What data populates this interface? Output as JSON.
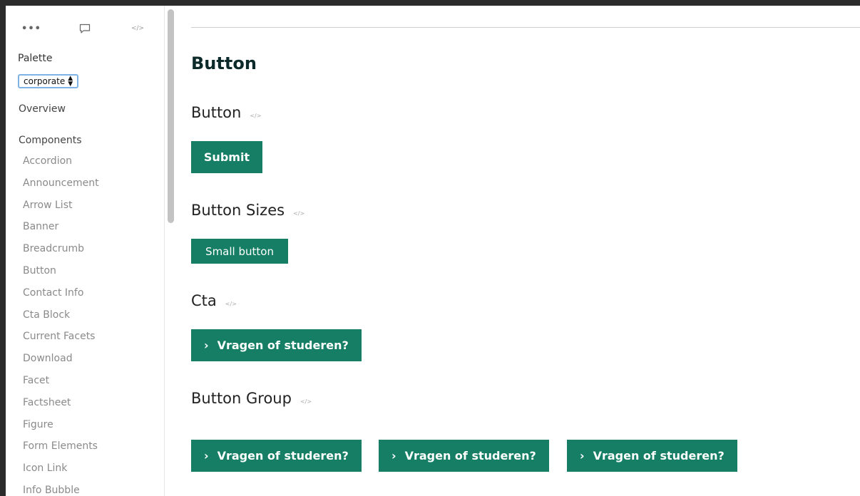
{
  "sidebar": {
    "toolbar": {
      "more": "•••",
      "code": "</>"
    },
    "palette_label": "Palette",
    "palette_value": "corporate",
    "overview": "Overview",
    "components_heading": "Components",
    "items": [
      "Accordion",
      "Announcement",
      "Arrow List",
      "Banner",
      "Breadcrumb",
      "Button",
      "Contact Info",
      "Cta Block",
      "Current Facets",
      "Download",
      "Facet",
      "Factsheet",
      "Figure",
      "Form Elements",
      "Icon Link",
      "Info Bubble"
    ]
  },
  "main": {
    "title": "Button",
    "code_icon": "</>",
    "sections": {
      "button": {
        "title": "Button",
        "button_label": "Submit"
      },
      "sizes": {
        "title": "Button Sizes",
        "button_label": "Small button"
      },
      "cta": {
        "title": "Cta",
        "button_label": "Vragen of studeren?"
      },
      "group": {
        "title": "Button Group",
        "buttons": [
          "Vragen of studeren?",
          "Vragen of studeren?",
          "Vragen of studeren?"
        ]
      }
    }
  },
  "colors": {
    "button_bg": "#157e64",
    "title": "#0d2a2a"
  }
}
